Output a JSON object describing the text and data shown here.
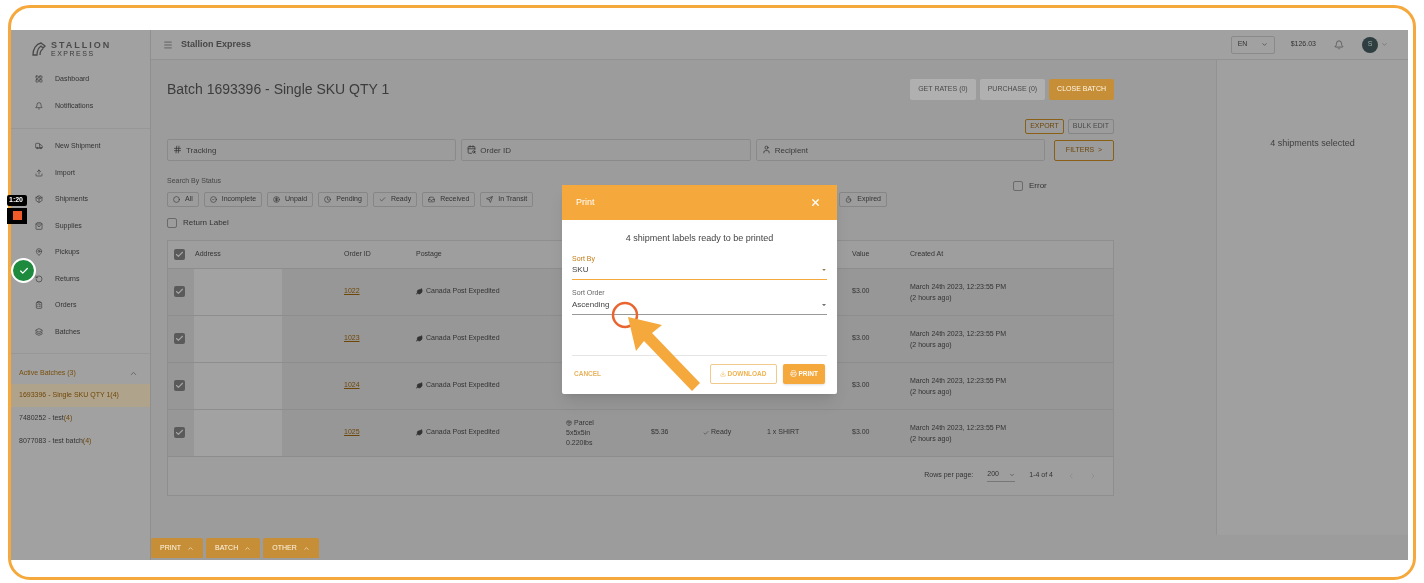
{
  "brand": {
    "name": "STALLION",
    "tagline": "EXPRESS"
  },
  "header": {
    "title": "Stallion Express",
    "language": "EN",
    "balance": "$126.03",
    "avatar": "S"
  },
  "sidebar": {
    "top_items": [
      {
        "label": "Dashboard"
      },
      {
        "label": "Notifications"
      }
    ],
    "items": [
      {
        "label": "New Shipment"
      },
      {
        "label": "Import"
      },
      {
        "label": "Shipments"
      },
      {
        "label": "Supplies"
      },
      {
        "label": "Pickups"
      },
      {
        "label": "Returns"
      },
      {
        "label": "Orders"
      },
      {
        "label": "Batches"
      }
    ],
    "active_batches": {
      "title": "Active Batches (3)",
      "expanded": true,
      "items": [
        {
          "name": "1693396 - Single SKU QTY 1",
          "count": "(4)",
          "selected": true
        },
        {
          "name": "7480252 - test",
          "count": "(4)",
          "selected": false
        },
        {
          "name": "8077083 - test batch",
          "count": "(4)",
          "selected": false
        }
      ]
    }
  },
  "recorder": {
    "time": "1:20"
  },
  "page": {
    "title": "Batch 1693396 - Single SKU QTY 1",
    "actions": [
      {
        "label": "GET RATES (0)",
        "kind": "disabled"
      },
      {
        "label": "PURCHASE (0)",
        "kind": "disabled"
      },
      {
        "label": "CLOSE BATCH",
        "kind": "primary"
      }
    ],
    "secondary_actions": [
      {
        "label": "EXPORT",
        "disabled": false
      },
      {
        "label": "BULK EDIT",
        "disabled": true
      }
    ],
    "search_fields": [
      {
        "placeholder": "Tracking"
      },
      {
        "placeholder": "Order ID"
      },
      {
        "placeholder": "Recipient"
      }
    ],
    "filters_button": "FILTERS  >",
    "status_title": "Search By Status",
    "statuses": [
      {
        "label": "All"
      },
      {
        "label": "Incomplete"
      },
      {
        "label": "Unpaid"
      },
      {
        "label": "Pending"
      },
      {
        "label": "Ready"
      },
      {
        "label": "Received"
      },
      {
        "label": "In Transit"
      },
      {
        "label": "Expired",
        "after_gap": true
      }
    ],
    "error_filter": {
      "label": "Error",
      "checked": false
    },
    "return_label": {
      "label": "Return Label",
      "checked": false
    }
  },
  "table": {
    "select_all": true,
    "headers": {
      "address": "Address",
      "order_id": "Order ID",
      "postage": "Postage",
      "value": "Value",
      "created_at": "Created At"
    },
    "rows": [
      {
        "checked": true,
        "order_id": "1022",
        "postage": "Canada Post Expedited",
        "value": "$3.00",
        "created": "March 24th 2023, 12:23:55 PM",
        "ago": "(2 hours ago)"
      },
      {
        "checked": true,
        "order_id": "1023",
        "postage": "Canada Post Expedited",
        "value": "$3.00",
        "created": "March 24th 2023, 12:23:55 PM",
        "ago": "(2 hours ago)"
      },
      {
        "checked": true,
        "order_id": "1024",
        "postage": "Canada Post Expedited",
        "value": "$3.00",
        "created": "March 24th 2023, 12:23:55 PM",
        "ago": "(2 hours ago)"
      },
      {
        "checked": true,
        "order_id": "1025",
        "postage": "Canada Post Expedited",
        "package": [
          "Parcel",
          "5x5x5in",
          "0.220lbs"
        ],
        "rate": "$5.36",
        "status": "Ready",
        "items": "1 x SHIRT",
        "value": "$3.00",
        "created": "March 24th 2023, 12:23:55 PM",
        "ago": "(2 hours ago)"
      }
    ],
    "pagination": {
      "rows_label": "Rows per page:",
      "rows_value": "200",
      "range": "1-4 of 4"
    }
  },
  "right_panel": {
    "text": "4 shipments selected"
  },
  "bottom_bar": [
    {
      "label": "PRINT"
    },
    {
      "label": "BATCH"
    },
    {
      "label": "OTHER"
    }
  ],
  "dialog": {
    "title": "Print",
    "message": "4 shipment labels ready to be printed",
    "fields": [
      {
        "label": "Sort By",
        "value": "SKU",
        "focused": true
      },
      {
        "label": "Sort Order",
        "value": "Ascending",
        "focused": false
      }
    ],
    "cancel": "CANCEL",
    "download": "DOWNLOAD",
    "print": "PRINT"
  }
}
